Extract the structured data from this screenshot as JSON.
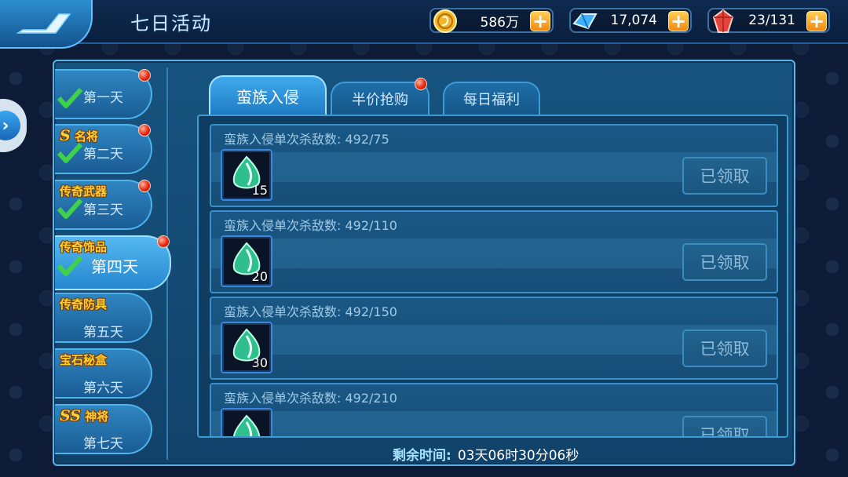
{
  "header": {
    "title": "七日活动",
    "resources": [
      {
        "icon": "gold-coin-icon",
        "value": "586万"
      },
      {
        "icon": "blue-crystal-icon",
        "value": "17,074"
      },
      {
        "icon": "red-gem-icon",
        "value": "23/131"
      }
    ]
  },
  "days": [
    {
      "label": "第一天",
      "tag": "",
      "tag_prefix": "",
      "checked": true,
      "red_dot": true
    },
    {
      "label": "第二天",
      "tag": "名将",
      "tag_prefix": "S",
      "checked": true,
      "red_dot": true
    },
    {
      "label": "第三天",
      "tag": "传奇武器",
      "tag_prefix": "",
      "checked": true,
      "red_dot": true
    },
    {
      "label": "第四天",
      "tag": "传奇饰品",
      "tag_prefix": "",
      "checked": true,
      "red_dot": true,
      "active": true
    },
    {
      "label": "第五天",
      "tag": "传奇防具",
      "tag_prefix": "",
      "checked": false,
      "red_dot": false
    },
    {
      "label": "第六天",
      "tag": "宝石秘盒",
      "tag_prefix": "",
      "checked": false,
      "red_dot": false
    },
    {
      "label": "第七天",
      "tag": "神将",
      "tag_prefix": "SS",
      "checked": false,
      "red_dot": false
    }
  ],
  "tabs": [
    {
      "label": "蛮族入侵",
      "active": true,
      "red_dot": false
    },
    {
      "label": "半价抢购",
      "active": false,
      "red_dot": true
    },
    {
      "label": "每日福利",
      "active": false,
      "red_dot": false
    }
  ],
  "tasks": [
    {
      "title": "蛮族入侵单次杀敌数: 492/75",
      "reward_qty": "15",
      "button": "已领取"
    },
    {
      "title": "蛮族入侵单次杀敌数: 492/110",
      "reward_qty": "20",
      "button": "已领取"
    },
    {
      "title": "蛮族入侵单次杀敌数: 492/150",
      "reward_qty": "30",
      "button": "已领取"
    },
    {
      "title": "蛮族入侵单次杀敌数: 492/210",
      "reward_qty": "",
      "button": "已领取"
    }
  ],
  "footer": {
    "timer_label": "剩余时间:",
    "timer_value": "03天06时30分06秒"
  },
  "colors": {
    "accent": "#3fa9ec",
    "tag_gold": "#ffcf33",
    "plus_orange": "#f08a12",
    "check_green": "#3fd14a"
  }
}
